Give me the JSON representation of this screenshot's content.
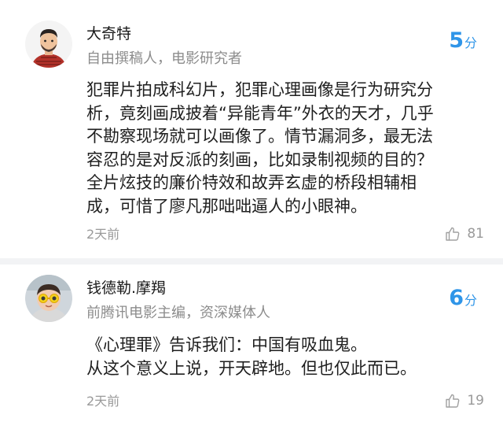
{
  "reviews": [
    {
      "user": "大奇特",
      "title": "自由撰稿人，电影研究者",
      "score": "5",
      "score_unit": "分",
      "content": "犯罪片拍成科幻片，犯罪心理画像是行为研究分\n析，竟刻画成披着“异能青年”外衣的天才，几乎\n不勘察现场就可以画像了。情节漏洞多，最无法\n容忍的是对反派的刻画，比如录制视频的目的？\n全片炫技的廉价特效和故弄玄虚的桥段相辅相\n成，可惜了廖凡那咄咄逼人的小眼神。",
      "time": "2天前",
      "likes": "81",
      "avatar_icon": "cartoon-man-avatar-icon"
    },
    {
      "user": "钱德勒.摩羯",
      "title": "前腾讯电影主编，资深媒体人",
      "score": "6",
      "score_unit": "分",
      "content": "《心理罪》告诉我们：中国有吸血鬼。\n从这个意义上说，开天辟地。但也仅此而已。",
      "time": "2天前",
      "likes": "19",
      "avatar_icon": "child-sunglasses-avatar-icon"
    }
  ],
  "colors": {
    "score": "#2f95e8",
    "meta": "#9a9a9a",
    "divider": "#f2f3f5"
  },
  "icons": {
    "like": "thumbs-up-icon"
  }
}
